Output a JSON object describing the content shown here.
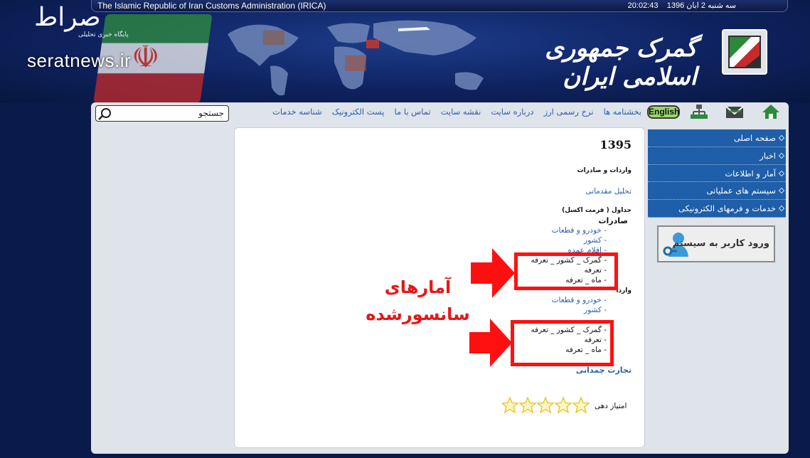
{
  "topbar": {
    "title": "The Islamic Republic of Iran Customs Administration (IRICA)",
    "time": "20:02:43",
    "date": "سه شنبه 2 ابان 1396"
  },
  "watermark": {
    "logo_text": "صراط",
    "tagline": "پایگاه خبری تحلیلی",
    "site": "seratnews.ir"
  },
  "brand": {
    "title": "گمرک جمهوری اسلامی ایران"
  },
  "search": {
    "label": "جستجو"
  },
  "nav": {
    "english": "English",
    "links": [
      "بخشنامه ها",
      "نرخ رسمی ارز",
      "درباره سایت",
      "نقشه سایت",
      "تماس با ما",
      "پست الکترونیک",
      "شناسه خدمات"
    ]
  },
  "sidebar": {
    "items": [
      "صفحه اصلی",
      "اخبار",
      "آمار و اطلاعات",
      "سیستم های عملیاتی",
      "خدمات و فرمهای الکترونیکی"
    ]
  },
  "login": {
    "label": "ورود کاربر به سیستم"
  },
  "content": {
    "year": "1395",
    "section_title": "واردات و صادرات",
    "preliminary": "تحلیل مقدماتی",
    "tables_heading": "جداول ( فرمت اکسل)",
    "exports_heading": "صادرات",
    "exports_links": [
      "- خودرو و قطعات",
      "- کشور",
      "- اقلام عمده"
    ],
    "exports_censored": [
      "- گمرک _ کشور _ تعرفه",
      "- تعرفه",
      "- ماه _ تعرفه"
    ],
    "imports_heading": "واردا",
    "imports_links": [
      "- خودرو و قطعات",
      "- کشور"
    ],
    "imports_censored": [
      "- گمرک _ کشور _ تعرفه",
      "- تعرفه",
      "- ماه _ تعرفه"
    ],
    "trade_link": "تجارت چمدانی",
    "rating_label": "امتیاز دهی",
    "rating_value": 0,
    "rating_max": 5
  },
  "annotation": {
    "line1": "آمارهای",
    "line2": "سانسورشده",
    "color": "#ff1010"
  }
}
